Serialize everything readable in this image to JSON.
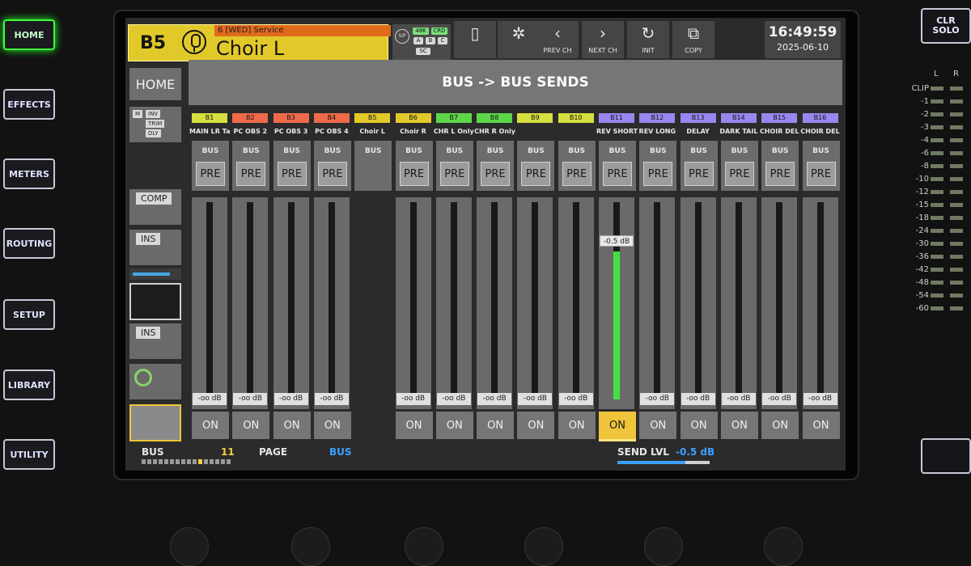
{
  "hardware": {
    "left_buttons": [
      "HOME",
      "EFFECTS",
      "METERS",
      "ROUTING",
      "SETUP",
      "LIBRARY",
      "UTILITY"
    ],
    "active_button": "HOME",
    "clr_solo": [
      "CLR",
      "SOLO"
    ]
  },
  "meter": {
    "headers": [
      "L",
      "R"
    ],
    "labels": [
      "CLIP",
      "-1",
      "-2",
      "-3",
      "-4",
      "-6",
      "-8",
      "-10",
      "-12",
      "-15",
      "-18",
      "-24",
      "-30",
      "-36",
      "-42",
      "-48",
      "-54",
      "-60"
    ]
  },
  "channel": {
    "number": "B5",
    "scene": "6 [WED] Service",
    "name": "Choir L",
    "color": "#e2c92a"
  },
  "status": {
    "sip": "SIP",
    "rate": "48K",
    "crd": "CRD",
    "a": "A",
    "b": "B",
    "c": "C",
    "sc": "SC"
  },
  "toolbar": {
    "prev_ch": "PREV CH",
    "next_ch": "NEXT CH",
    "init": "INIT",
    "copy": "COPY"
  },
  "clock": {
    "time": "16:49:59",
    "date": "2025-06-10"
  },
  "home_label": "HOME",
  "title": "BUS -> BUS SENDS",
  "left_panel": {
    "proc_tags": [
      "M",
      "INV",
      "TRIM",
      "DLY"
    ],
    "comp": "COMP",
    "ins1": "INS",
    "ins2": "INS"
  },
  "strips": [
    {
      "id": "B1",
      "name": "MAIN LR Ta",
      "color": "#d6df3e",
      "bus": "BUS",
      "pre": "PRE",
      "level": "-oo dB",
      "on": "ON",
      "on_state": "off",
      "send": 0
    },
    {
      "id": "B2",
      "name": "PC OBS 2",
      "color": "#ef6a4a",
      "bus": "BUS",
      "pre": "PRE",
      "level": "-oo dB",
      "on": "ON",
      "on_state": "off",
      "send": 0
    },
    {
      "id": "B3",
      "name": "PC OBS 3",
      "color": "#ef6a4a",
      "bus": "BUS",
      "pre": "PRE",
      "level": "-oo dB",
      "on": "ON",
      "on_state": "off",
      "send": 0
    },
    {
      "id": "B4",
      "name": "PC OBS 4",
      "color": "#ef6a4a",
      "bus": "BUS",
      "pre": "PRE",
      "level": "-oo dB",
      "on": "ON",
      "on_state": "off",
      "send": 0
    },
    {
      "id": "B5",
      "name": "Choir L",
      "color": "#e2c92a",
      "bus": "BUS",
      "pre": "",
      "level": "",
      "on": "",
      "on_state": "self",
      "send": 0
    },
    {
      "id": "B6",
      "name": "Choir R",
      "color": "#e2c92a",
      "bus": "BUS",
      "pre": "PRE",
      "level": "-oo dB",
      "on": "ON",
      "on_state": "off",
      "send": 0
    },
    {
      "id": "B7",
      "name": "CHR L Only",
      "color": "#5ed64a",
      "bus": "BUS",
      "pre": "PRE",
      "level": "-oo dB",
      "on": "ON",
      "on_state": "off",
      "send": 0
    },
    {
      "id": "B8",
      "name": "CHR R Only",
      "color": "#5ed64a",
      "bus": "BUS",
      "pre": "PRE",
      "level": "-oo dB",
      "on": "ON",
      "on_state": "off",
      "send": 0
    },
    {
      "id": "B9",
      "name": "",
      "color": "#d6df3e",
      "bus": "BUS",
      "pre": "PRE",
      "level": "-oo dB",
      "on": "ON",
      "on_state": "off",
      "send": 0
    },
    {
      "id": "B10",
      "name": "",
      "color": "#d6df3e",
      "bus": "BUS",
      "pre": "PRE",
      "level": "-oo dB",
      "on": "ON",
      "on_state": "off",
      "send": 0
    },
    {
      "id": "B11",
      "name": "REV SHORT",
      "color": "#9a86f0",
      "bus": "BUS",
      "pre": "PRE",
      "level": "-0.5 dB",
      "on": "ON",
      "on_state": "on",
      "send": 0.75
    },
    {
      "id": "B12",
      "name": "REV LONG",
      "color": "#9a86f0",
      "bus": "BUS",
      "pre": "PRE",
      "level": "-oo dB",
      "on": "ON",
      "on_state": "off",
      "send": 0
    },
    {
      "id": "B13",
      "name": "DELAY",
      "color": "#9a86f0",
      "bus": "BUS",
      "pre": "PRE",
      "level": "-oo dB",
      "on": "ON",
      "on_state": "off",
      "send": 0
    },
    {
      "id": "B14",
      "name": "DARK TAIL",
      "color": "#9a86f0",
      "bus": "BUS",
      "pre": "PRE",
      "level": "-oo dB",
      "on": "ON",
      "on_state": "off",
      "send": 0
    },
    {
      "id": "B15",
      "name": "CHOIR DEL",
      "color": "#9a86f0",
      "bus": "BUS",
      "pre": "PRE",
      "level": "-oo dB",
      "on": "ON",
      "on_state": "off",
      "send": 0
    },
    {
      "id": "B16",
      "name": "CHOIR DEL",
      "color": "#9a86f0",
      "bus": "BUS",
      "pre": "PRE",
      "level": "-oo dB",
      "on": "ON",
      "on_state": "off",
      "send": 0
    }
  ],
  "bottom": {
    "bus_label": "BUS",
    "bus_count": "11",
    "page_label": "PAGE",
    "page_value": "BUS",
    "send_lvl_label": "SEND LVL",
    "send_lvl_value": "-0.5 dB"
  }
}
